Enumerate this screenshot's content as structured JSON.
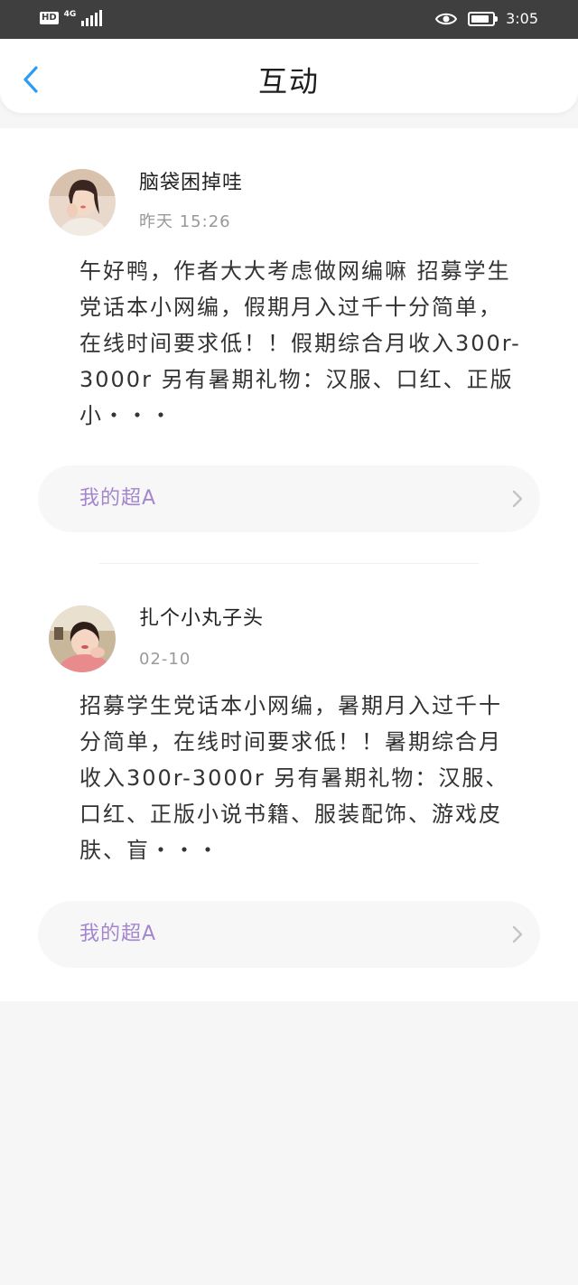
{
  "status_bar": {
    "hd": "HD",
    "network": "4G",
    "time": "3:05",
    "battery_level": 0.85
  },
  "nav": {
    "title": "互动",
    "back_icon": "chevron-left-icon",
    "accent_color": "#2d9cf2"
  },
  "posts": [
    {
      "username": "脑袋困掉哇",
      "time": "昨天  15:26",
      "content": "午好鸭，作者大大考虑做网编嘛 招募学生党话本小网编，假期月入过千十分简单，在线时间要求低！！假期综合月收入300r-3000r 另有暑期礼物：汉服、口红、正版小・・・",
      "tag": "我的超A",
      "tag_icon": "chevron-right-icon"
    },
    {
      "username": "扎个小丸子头",
      "time": "02-10",
      "content": "招募学生党话本小网编，暑期月入过千十分简单，在线时间要求低！！暑期综合月收入300r-3000r 另有暑期礼物：汉服、口红、正版小说书籍、服装配饰、游戏皮肤、盲・・・",
      "tag": "我的超A",
      "tag_icon": "chevron-right-icon"
    }
  ],
  "colors": {
    "tag_text": "#a486cf",
    "background": "#f7f6f7",
    "status_bar": "#3f3f3f"
  }
}
